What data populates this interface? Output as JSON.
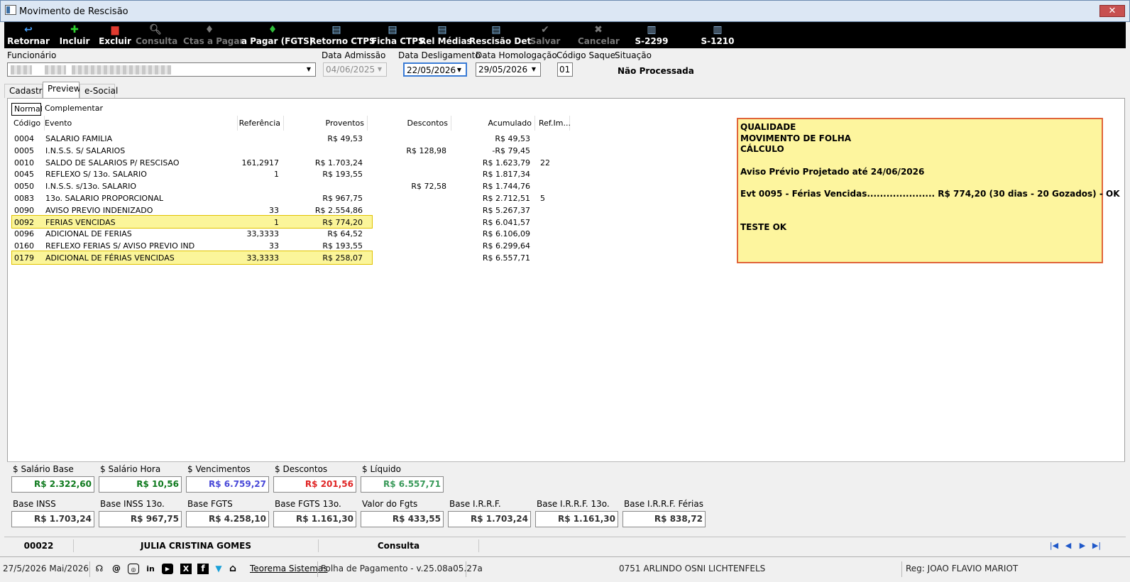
{
  "window": {
    "title": "Movimento de Rescisão",
    "close_label": "✕"
  },
  "toolbar": [
    {
      "label": "Retornar",
      "icon": "return-arrow-icon",
      "glyph": "↩",
      "color": "#4aa3ff",
      "enabled": true
    },
    {
      "label": "Incluir",
      "icon": "plus-icon",
      "glyph": "✚",
      "color": "#2fd12f",
      "enabled": true
    },
    {
      "label": "Excluir",
      "icon": "trash-icon",
      "glyph": "▆",
      "color": "#e03a2f",
      "enabled": true
    },
    {
      "label": "Consulta",
      "icon": "magnifier-icon",
      "glyph": "🔍︎",
      "color": "#7a7a7a",
      "enabled": false
    },
    {
      "label": "Ctas a Pagar",
      "icon": "money-bag-icon",
      "glyph": "♦",
      "color": "#7a7a7a",
      "enabled": false
    },
    {
      "label": "a Pagar (FGTS)",
      "icon": "money-bag-icon",
      "glyph": "♦",
      "color": "#2fbf3a",
      "enabled": true
    },
    {
      "label": "Retorno CTPS",
      "icon": "printer-icon",
      "glyph": "▤",
      "color": "#8fc8f5",
      "enabled": true
    },
    {
      "label": "Ficha CTPS",
      "icon": "printer-icon",
      "glyph": "▤",
      "color": "#8fc8f5",
      "enabled": true
    },
    {
      "label": "Rel Médias",
      "icon": "printer-icon",
      "glyph": "▤",
      "color": "#8fc8f5",
      "enabled": true
    },
    {
      "label": "Rescisão Det",
      "icon": "printer-icon",
      "glyph": "▤",
      "color": "#8fc8f5",
      "enabled": true
    },
    {
      "label": "Salvar",
      "icon": "checkmark-icon",
      "glyph": "✔",
      "color": "#7a7a7a",
      "enabled": false
    },
    {
      "label": "Cancelar",
      "icon": "x-icon",
      "glyph": "✖",
      "color": "#7a7a7a",
      "enabled": false
    },
    {
      "label": "S-2299",
      "icon": "document-icon",
      "glyph": "▥",
      "color": "#9ec8f0",
      "enabled": true
    },
    {
      "label": "S-1210",
      "icon": "document-icon",
      "glyph": "▥",
      "color": "#9ec8f0",
      "enabled": true
    }
  ],
  "header": {
    "funcionario_label": "Funcionário",
    "data_admissao_label": "Data Admissão",
    "data_admissao": "04/06/2025",
    "data_desligamento_label": "Data Desligamento",
    "data_desligamento": "22/05/2026",
    "data_homologacao_label": "Data Homologação",
    "data_homologacao": "29/05/2026",
    "codigo_saque_label": "Código Saque",
    "codigo_saque": "01",
    "situacao_label": "Situação",
    "situacao": "Não Processada"
  },
  "tabs": [
    "Cadastro",
    "Preview",
    "e-Social"
  ],
  "active_tab": "Preview",
  "subtabs": [
    "Normal",
    "Complementar"
  ],
  "grid": {
    "headers": {
      "codigo": "Código",
      "evento": "Evento",
      "referencia": "Referência",
      "proventos": "Proventos",
      "descontos": "Descontos",
      "acumulado": "Acumulado",
      "refim": "Ref.Im..."
    },
    "rows": [
      {
        "codigo": "0004",
        "evento": "SALARIO FAMILIA",
        "referencia": "",
        "proventos": "R$ 49,53",
        "descontos": "",
        "acumulado": "R$ 49,53",
        "refim": "",
        "hl": false
      },
      {
        "codigo": "0005",
        "evento": "I.N.S.S. S/ SALARIOS",
        "referencia": "",
        "proventos": "",
        "descontos": "R$ 128,98",
        "acumulado": "-R$ 79,45",
        "refim": "",
        "hl": false
      },
      {
        "codigo": "0010",
        "evento": "SALDO DE SALARIOS P/ RESCISAO",
        "referencia": "161,2917",
        "proventos": "R$ 1.703,24",
        "descontos": "",
        "acumulado": "R$ 1.623,79",
        "refim": "22",
        "hl": false
      },
      {
        "codigo": "0045",
        "evento": "REFLEXO S/ 13o. SALARIO",
        "referencia": "1",
        "proventos": "R$ 193,55",
        "descontos": "",
        "acumulado": "R$ 1.817,34",
        "refim": "",
        "hl": false
      },
      {
        "codigo": "0050",
        "evento": "I.N.S.S. s/13o. SALARIO",
        "referencia": "",
        "proventos": "",
        "descontos": "R$ 72,58",
        "acumulado": "R$ 1.744,76",
        "refim": "",
        "hl": false
      },
      {
        "codigo": "0083",
        "evento": "13o. SALARIO PROPORCIONAL",
        "referencia": "",
        "proventos": "R$ 967,75",
        "descontos": "",
        "acumulado": "R$ 2.712,51",
        "refim": "5",
        "hl": false
      },
      {
        "codigo": "0090",
        "evento": "AVISO PREVIO INDENIZADO",
        "referencia": "33",
        "proventos": "R$ 2.554,86",
        "descontos": "",
        "acumulado": "R$ 5.267,37",
        "refim": "",
        "hl": false
      },
      {
        "codigo": "0092",
        "evento": "FERIAS VENCIDAS",
        "referencia": "1",
        "proventos": "R$ 774,20",
        "descontos": "",
        "acumulado": "R$ 6.041,57",
        "refim": "",
        "hl": true
      },
      {
        "codigo": "0096",
        "evento": "ADICIONAL DE FERIAS",
        "referencia": "33,3333",
        "proventos": "R$ 64,52",
        "descontos": "",
        "acumulado": "R$ 6.106,09",
        "refim": "",
        "hl": false
      },
      {
        "codigo": "0160",
        "evento": "REFLEXO FERIAS S/ AVISO PREVIO IND",
        "referencia": "33",
        "proventos": "R$ 193,55",
        "descontos": "",
        "acumulado": "R$ 6.299,64",
        "refim": "",
        "hl": false
      },
      {
        "codigo": "0179",
        "evento": "ADICIONAL DE FÉRIAS VENCIDAS",
        "referencia": "33,3333",
        "proventos": "R$ 258,07",
        "descontos": "",
        "acumulado": "R$ 6.557,71",
        "refim": "",
        "hl": true
      }
    ]
  },
  "note": {
    "lines": [
      "QUALIDADE",
      "MOVIMENTO DE FOLHA",
      "CÁLCULO",
      "",
      "Aviso Prévio Projetado até 24/06/2026",
      "",
      "Evt 0095 - Férias Vencidas..................... R$    774,20 (30 dias - 20 Gozados) - OK",
      "",
      "",
      "TESTE OK"
    ]
  },
  "totals_row1": [
    {
      "label": "$ Salário Base",
      "value": "R$ 2.322,60",
      "color": "#0f7a1e"
    },
    {
      "label": "$ Salário Hora",
      "value": "R$ 10,56",
      "color": "#0f7a1e"
    },
    {
      "label": "$ Vencimentos",
      "value": "R$ 6.759,27",
      "color": "#4848d8"
    },
    {
      "label": "$ Descontos",
      "value": "R$ 201,56",
      "color": "#e02424"
    },
    {
      "label": "$ Líquido",
      "value": "R$ 6.557,71",
      "color": "#3a9a5a"
    }
  ],
  "totals_row2": [
    {
      "label": "Base INSS",
      "value": "R$ 1.703,24"
    },
    {
      "label": "Base INSS 13o.",
      "value": "R$ 967,75"
    },
    {
      "label": "Base FGTS",
      "value": "R$ 4.258,10"
    },
    {
      "label": "Base FGTS 13o.",
      "value": "R$ 1.161,30"
    },
    {
      "label": "Valor do Fgts",
      "value": "R$ 433,55"
    },
    {
      "label": "Base I.R.R.F.",
      "value": "R$ 1.703,24"
    },
    {
      "label": "Base I.R.R.F. 13o.",
      "value": "R$ 1.161,30"
    },
    {
      "label": "Base I.R.R.F. Férias",
      "value": "R$ 838,72"
    }
  ],
  "status1": {
    "codigo": "00022",
    "nome": "JULIA CRISTINA GOMES",
    "modo": "Consulta"
  },
  "status2": {
    "date": "27/5/2026 Mai/2026",
    "company_link": "Teorema Sistemas",
    "app": "Folha de Pagamento - v.25.08a05.27a",
    "empresa": "0751 ARLINDO OSNI LICHTENFELS",
    "reg": "Reg: JOAO FLAVIO MARIOT"
  }
}
